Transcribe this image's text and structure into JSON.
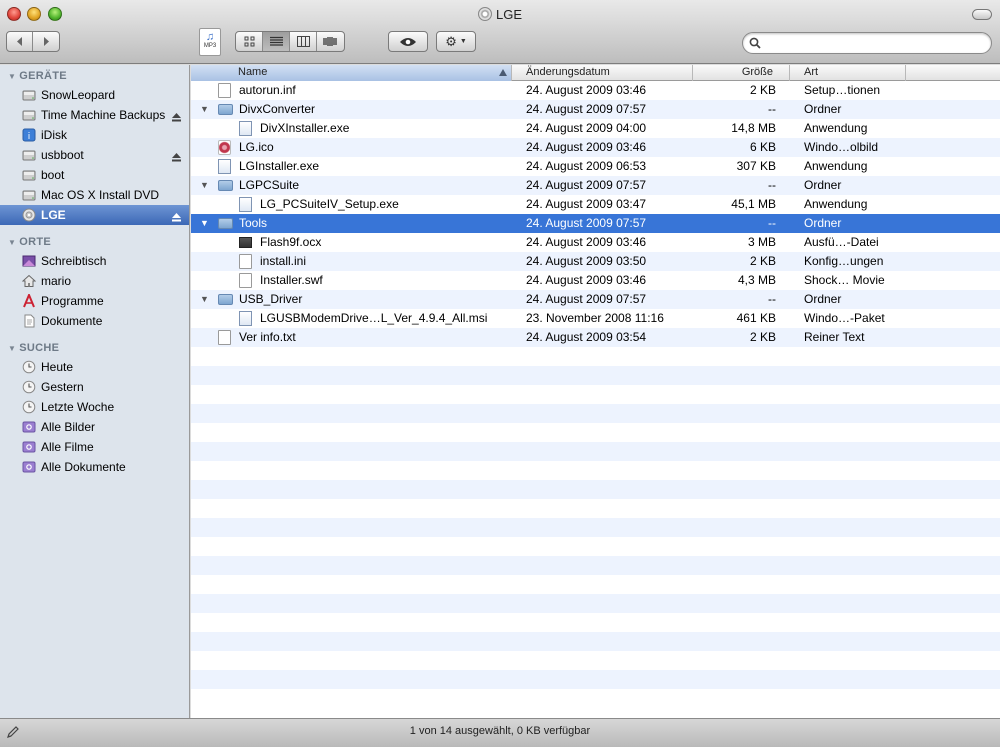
{
  "window": {
    "title": "LGE"
  },
  "toolbar": {
    "back_icon": "chevron-left-icon",
    "forward_icon": "chevron-right-icon",
    "view_modes": [
      "icon-view-icon",
      "list-view-icon",
      "column-view-icon",
      "coverflow-view-icon"
    ],
    "active_view": "list-view-icon",
    "quicklook_icon": "eye-icon",
    "action_icon": "gear-icon",
    "preview_badge": "MP3",
    "search": {
      "value": "",
      "placeholder": ""
    }
  },
  "sidebar": {
    "sections": [
      {
        "title": "GERÄTE",
        "items": [
          {
            "label": "SnowLeopard",
            "icon": "harddisk-icon",
            "eject": false
          },
          {
            "label": "Time Machine Backups",
            "icon": "harddisk-icon",
            "eject": true
          },
          {
            "label": "iDisk",
            "icon": "idisk-icon",
            "eject": false
          },
          {
            "label": "usbboot",
            "icon": "harddisk-icon",
            "eject": true
          },
          {
            "label": "boot",
            "icon": "harddisk-icon",
            "eject": false
          },
          {
            "label": "Mac OS X Install DVD",
            "icon": "harddisk-icon",
            "eject": false
          },
          {
            "label": "LGE",
            "icon": "cd-icon",
            "eject": true,
            "selected": true
          }
        ]
      },
      {
        "title": "ORTE",
        "items": [
          {
            "label": "Schreibtisch",
            "icon": "desktop-icon"
          },
          {
            "label": "mario",
            "icon": "home-icon"
          },
          {
            "label": "Programme",
            "icon": "applications-icon"
          },
          {
            "label": "Dokumente",
            "icon": "documents-icon"
          }
        ]
      },
      {
        "title": "SUCHE",
        "items": [
          {
            "label": "Heute",
            "icon": "clock-icon"
          },
          {
            "label": "Gestern",
            "icon": "clock-icon"
          },
          {
            "label": "Letzte Woche",
            "icon": "clock-icon"
          },
          {
            "label": "Alle Bilder",
            "icon": "smart-folder-icon"
          },
          {
            "label": "Alle Filme",
            "icon": "smart-folder-icon"
          },
          {
            "label": "Alle Dokumente",
            "icon": "smart-folder-icon"
          }
        ]
      }
    ]
  },
  "columns": {
    "name": "Name",
    "date": "Änderungsdatum",
    "size": "Größe",
    "kind": "Art"
  },
  "files": [
    {
      "name": "autorun.inf",
      "date": "24. August 2009 03:46",
      "size": "2 KB",
      "kind": "Setup…tionen",
      "icon": "document-icon",
      "level": 0,
      "folder": false
    },
    {
      "name": "DivxConverter",
      "date": "24. August 2009 07:57",
      "size": "--",
      "kind": "Ordner",
      "icon": "folder-icon",
      "level": 0,
      "folder": true
    },
    {
      "name": "DivXInstaller.exe",
      "date": "24. August 2009 04:00",
      "size": "14,8 MB",
      "kind": "Anwendung",
      "icon": "application-icon",
      "level": 1,
      "folder": false
    },
    {
      "name": "LG.ico",
      "date": "24. August 2009 03:46",
      "size": "6 KB",
      "kind": "Windo…olbild",
      "icon": "ico-file-icon",
      "level": 0,
      "folder": false
    },
    {
      "name": "LGInstaller.exe",
      "date": "24. August 2009 06:53",
      "size": "307 KB",
      "kind": "Anwendung",
      "icon": "application-icon",
      "level": 0,
      "folder": false
    },
    {
      "name": "LGPCSuite",
      "date": "24. August 2009 07:57",
      "size": "--",
      "kind": "Ordner",
      "icon": "folder-icon",
      "level": 0,
      "folder": true
    },
    {
      "name": "LG_PCSuiteIV_Setup.exe",
      "date": "24. August 2009 03:47",
      "size": "45,1 MB",
      "kind": "Anwendung",
      "icon": "application-icon",
      "level": 1,
      "folder": false
    },
    {
      "name": "Tools",
      "date": "24. August 2009 07:57",
      "size": "--",
      "kind": "Ordner",
      "icon": "folder-icon",
      "level": 0,
      "folder": true,
      "selected": true
    },
    {
      "name": "Flash9f.ocx",
      "date": "24. August 2009 03:46",
      "size": "3 MB",
      "kind": "Ausfü…-Datei",
      "icon": "executable-icon",
      "level": 1,
      "folder": false
    },
    {
      "name": "install.ini",
      "date": "24. August 2009 03:50",
      "size": "2 KB",
      "kind": "Konfig…ungen",
      "icon": "document-icon",
      "level": 1,
      "folder": false
    },
    {
      "name": "Installer.swf",
      "date": "24. August 2009 03:46",
      "size": "4,3 MB",
      "kind": "Shock… Movie",
      "icon": "document-icon",
      "level": 1,
      "folder": false
    },
    {
      "name": "USB_Driver",
      "date": "24. August 2009 07:57",
      "size": "--",
      "kind": "Ordner",
      "icon": "folder-icon",
      "level": 0,
      "folder": true
    },
    {
      "name": "LGUSBModemDrive…L_Ver_4.9.4_All.msi",
      "date": "23. November 2008 11:16",
      "size": "461 KB",
      "kind": "Windo…-Paket",
      "icon": "installer-icon",
      "level": 1,
      "folder": false
    },
    {
      "name": "Ver info.txt",
      "date": "24. August 2009 03:54",
      "size": "2 KB",
      "kind": "Reiner Text",
      "icon": "text-document-icon",
      "level": 0,
      "folder": false
    }
  ],
  "status": {
    "text": "1 von 14 ausgewählt, 0 KB verfügbar"
  },
  "colors": {
    "selection": "#3875d7",
    "sidebar_bg": "#dde4ec",
    "stripe": "#edf3fe"
  }
}
